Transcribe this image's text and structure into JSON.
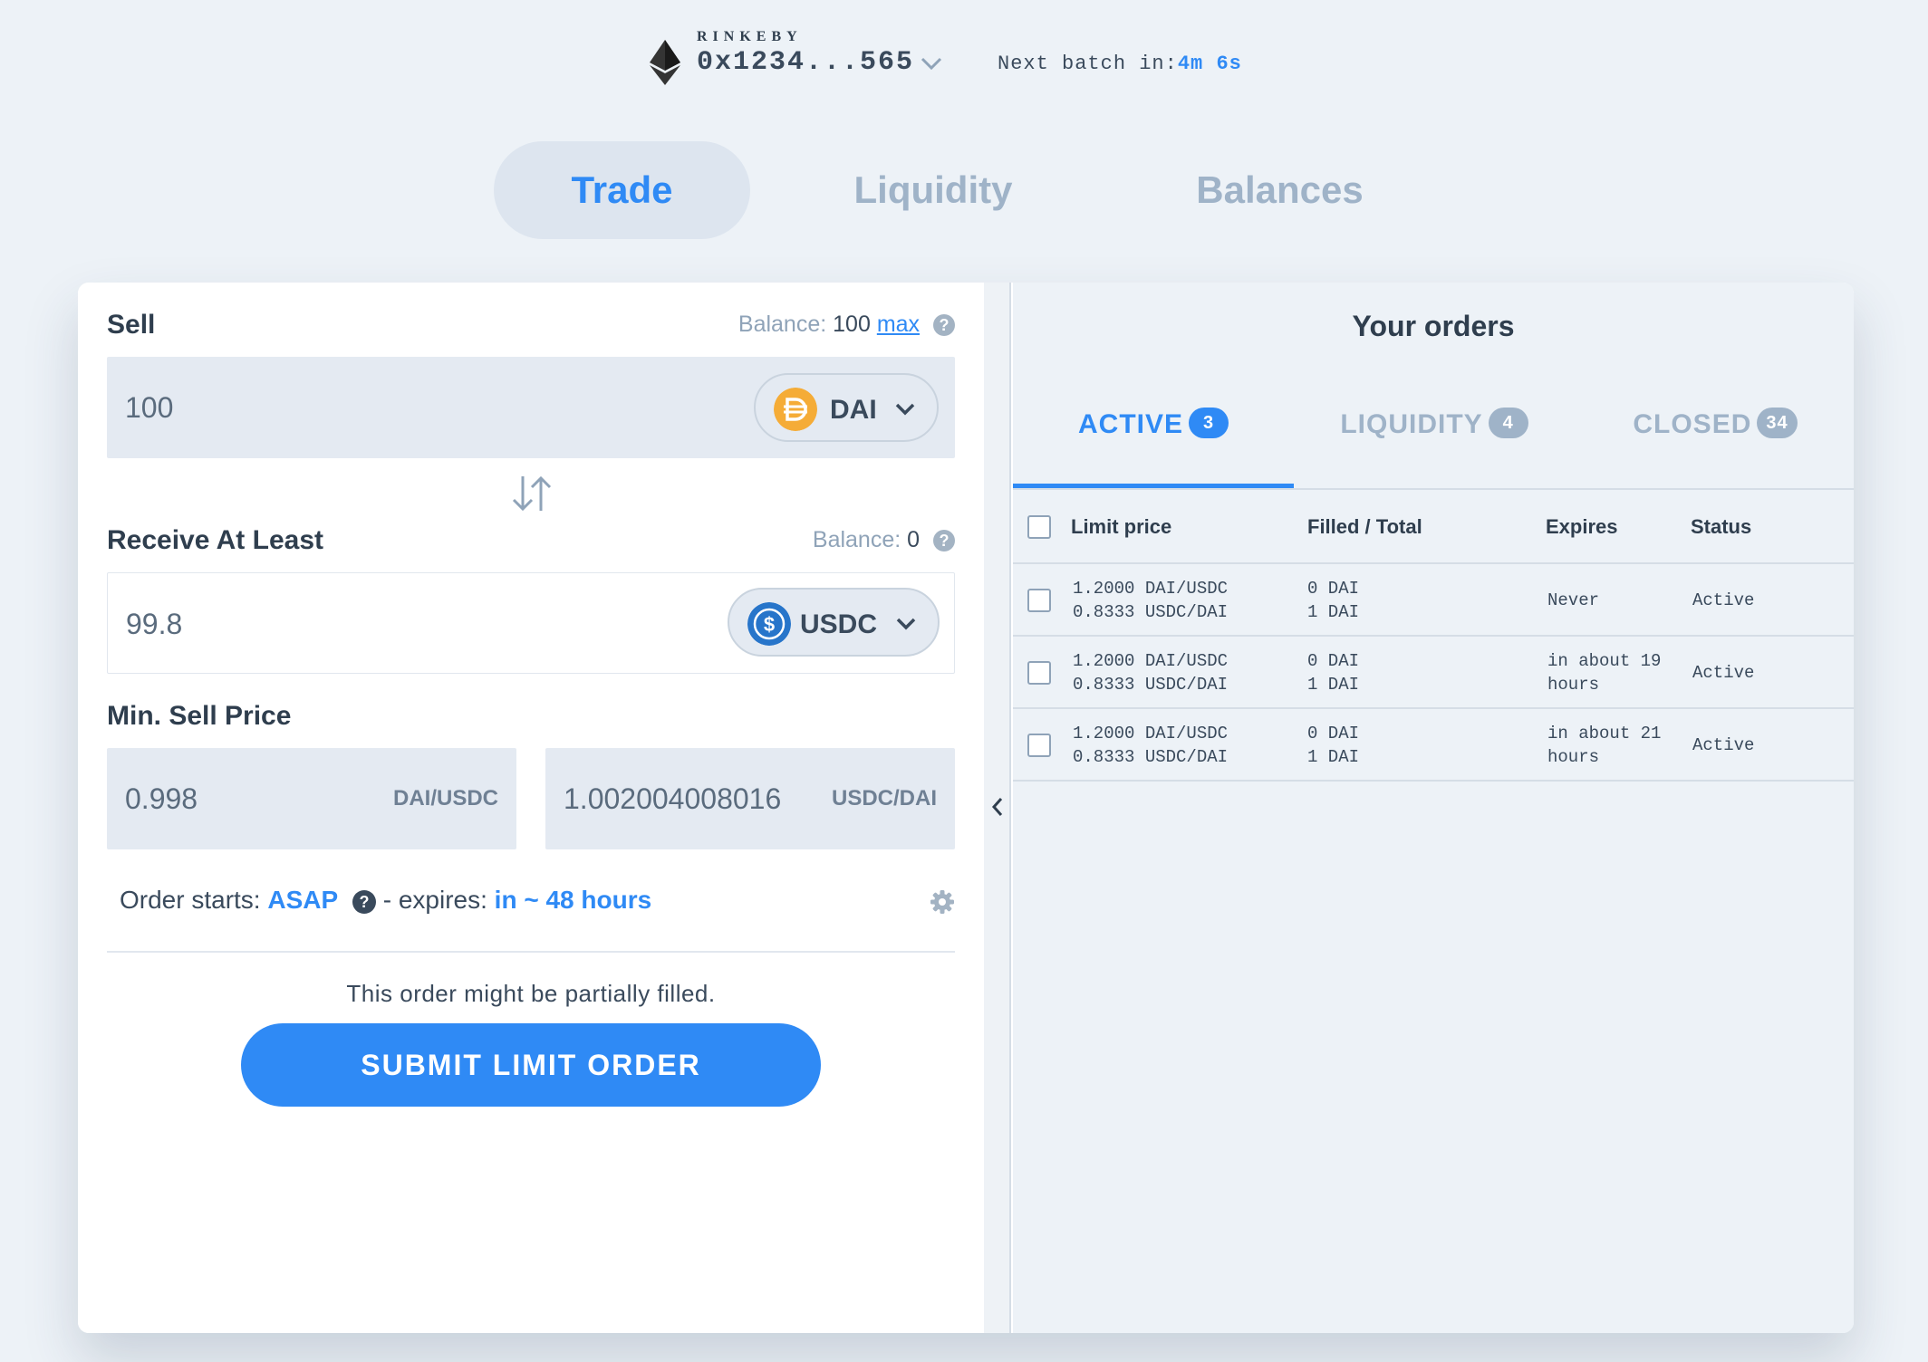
{
  "header": {
    "network": "RINKEBY",
    "address": "0x1234...565",
    "batch_label": "Next batch in:",
    "batch_time": "4m 6s"
  },
  "nav": {
    "tabs": [
      {
        "label": "Trade",
        "active": true
      },
      {
        "label": "Liquidity",
        "active": false
      },
      {
        "label": "Balances",
        "active": false
      }
    ]
  },
  "trade": {
    "sell_label": "Sell",
    "sell_balance_label": "Balance:",
    "sell_balance_value": "100",
    "sell_max": "max",
    "sell_amount": "100",
    "sell_token": "DAI",
    "receive_label": "Receive At Least",
    "receive_balance_label": "Balance:",
    "receive_balance_value": "0",
    "receive_amount": "99.8",
    "receive_token": "USDC",
    "min_price_label": "Min. Sell Price",
    "price_1_value": "0.998",
    "price_1_unit": "DAI/USDC",
    "price_2_value": "1.002004008016",
    "price_2_unit": "USDC/DAI",
    "order_starts_label": "Order starts:",
    "order_starts_value": "ASAP",
    "expires_label": "- expires:",
    "expires_value": "in ~ 48 hours",
    "partial_note": "This order might be partially filled.",
    "submit_label": "SUBMIT LIMIT ORDER"
  },
  "orders": {
    "title": "Your orders",
    "tabs": [
      {
        "label": "ACTIVE",
        "count": "3",
        "active": true
      },
      {
        "label": "LIQUIDITY",
        "count": "4",
        "active": false
      },
      {
        "label": "CLOSED",
        "count": "34",
        "active": false
      }
    ],
    "columns": [
      "Limit price",
      "Filled / Total",
      "Expires",
      "Status"
    ],
    "rows": [
      {
        "price_1": "1.2000 DAI/USDC",
        "price_2": "0.8333 USDC/DAI",
        "filled": "0 DAI",
        "total": "1 DAI",
        "expires_1": "Never",
        "expires_2": "",
        "status": "Active"
      },
      {
        "price_1": "1.2000 DAI/USDC",
        "price_2": "0.8333 USDC/DAI",
        "filled": "0 DAI",
        "total": "1 DAI",
        "expires_1": "in about 19",
        "expires_2": "hours",
        "status": "Active"
      },
      {
        "price_1": "1.2000 DAI/USDC",
        "price_2": "0.8333 USDC/DAI",
        "filled": "0 DAI",
        "total": "1 DAI",
        "expires_1": "in about 21",
        "expires_2": "hours",
        "status": "Active"
      }
    ]
  },
  "colors": {
    "accent": "#2f8af5",
    "background": "#edf2f7",
    "dai": "#f5ac37",
    "usdc": "#2775ca"
  },
  "icons": [
    "ethereum-icon",
    "chevron-down-icon",
    "swap-arrows-icon",
    "help-icon",
    "gear-icon",
    "chevron-left-icon",
    "dai-token-icon",
    "usdc-token-icon"
  ]
}
